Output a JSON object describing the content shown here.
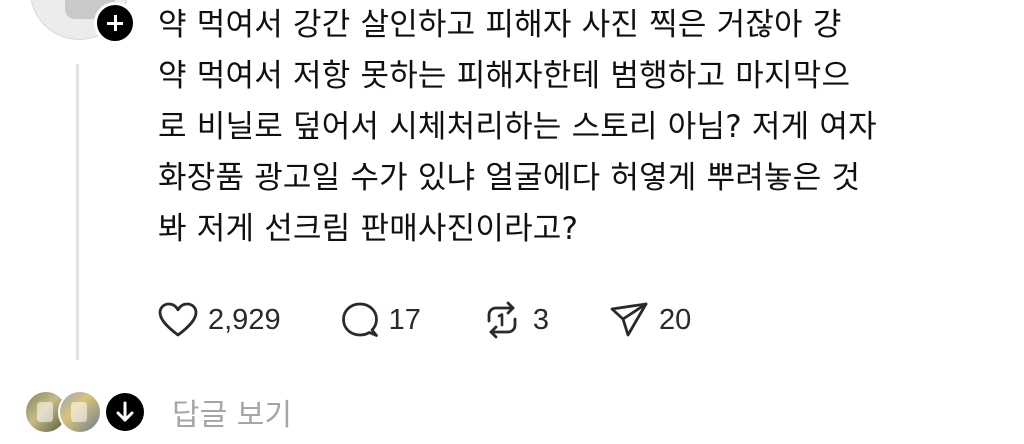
{
  "post": {
    "text": "약 먹여서 강간 살인하고 피해자 사진 찍은 거잖아 걍\n약 먹여서 저항 못하는 피해자한테 범행하고 마지막으\n로 비닐로 덮어서 시체처리하는 스토리 아님? 저게 여자\n화장품 광고일 수가 있냐 얼굴에다 허옇게 뿌려놓은 것\n봐 저게 선크림 판매사진이라고?"
  },
  "actions": {
    "like_count": "2,929",
    "comment_count": "17",
    "repost_count": "3",
    "share_count": "20"
  },
  "replies": {
    "label": "답글 보기"
  },
  "icons": {
    "follow": "plus-icon",
    "like": "heart-icon",
    "comment": "speech-bubble-icon",
    "repost": "repost-icon",
    "share": "send-icon",
    "expand": "arrow-down-icon"
  }
}
